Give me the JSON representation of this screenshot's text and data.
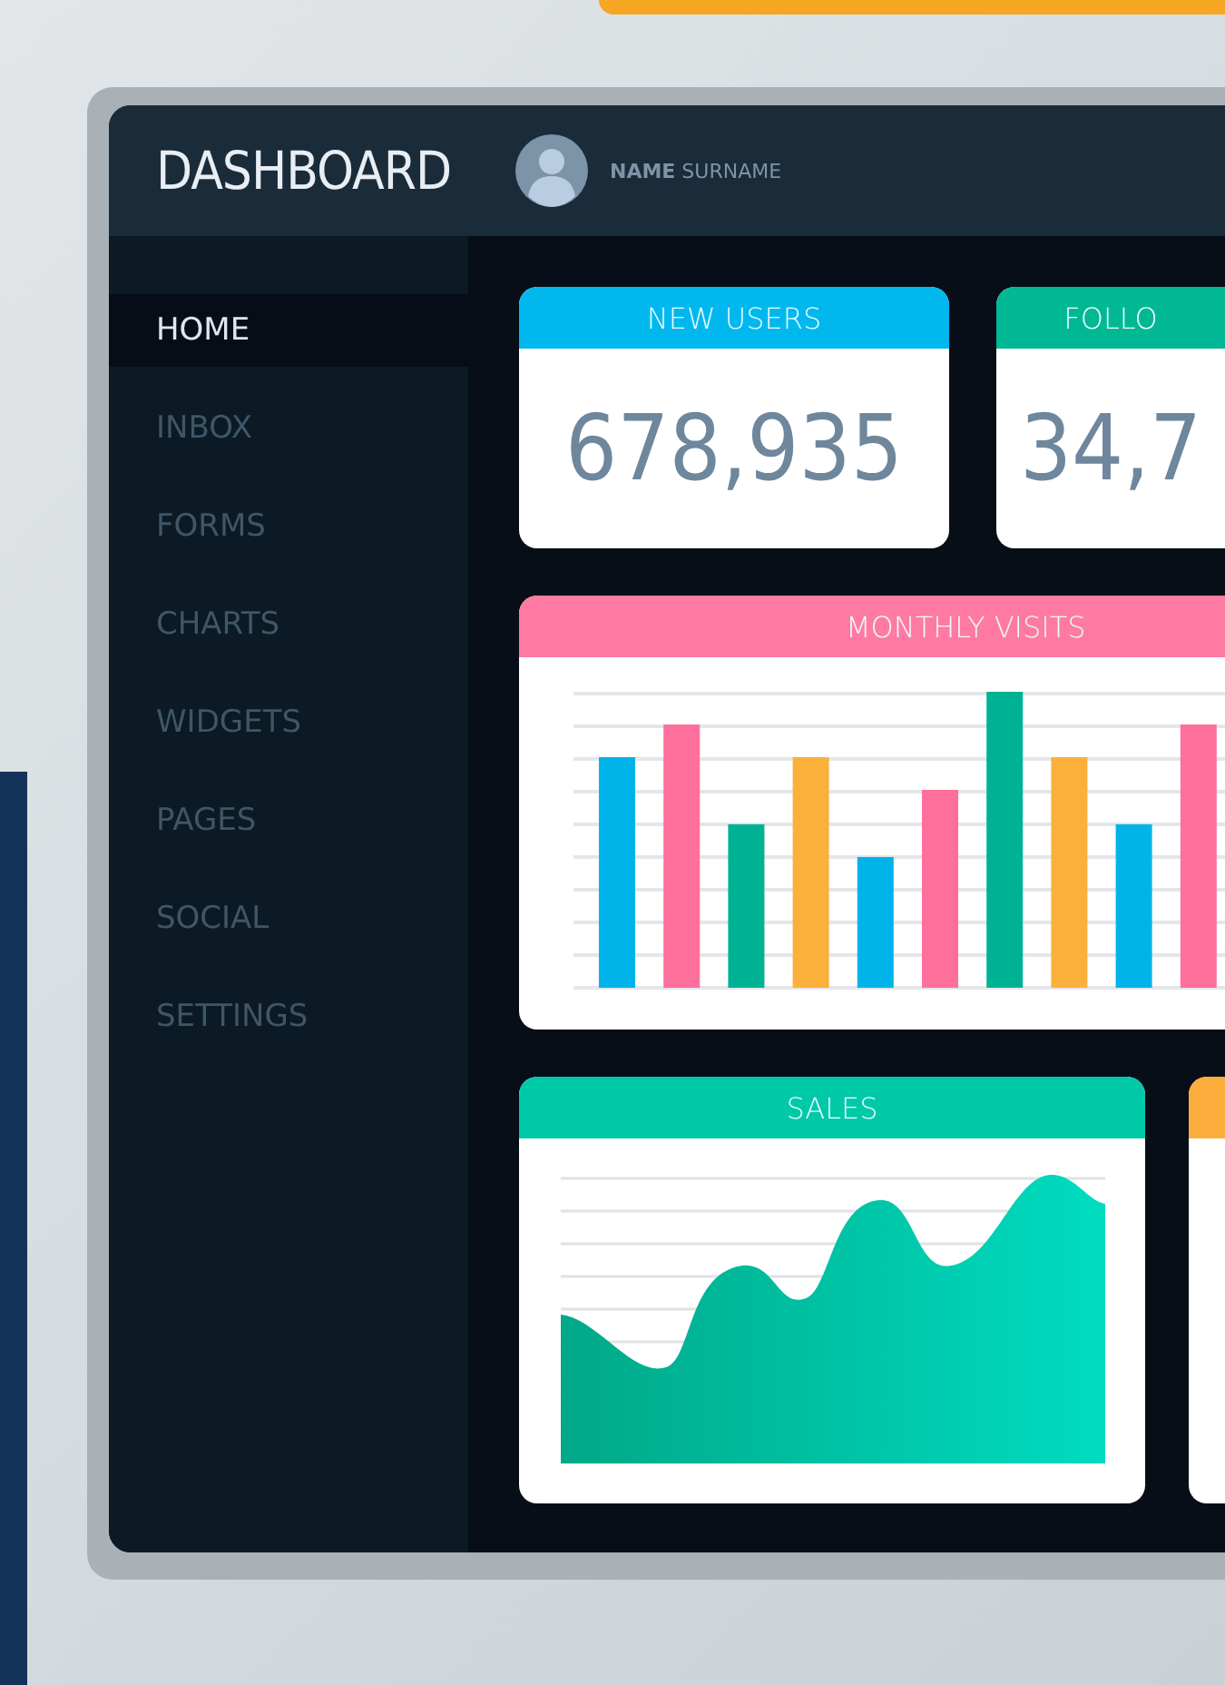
{
  "header": {
    "title": "DASHBOARD",
    "user_name": "**NAME** SURNAME"
  },
  "sidebar": {
    "items": [
      {
        "label": "HOME",
        "selected": true
      },
      {
        "label": "INBOX",
        "selected": false
      },
      {
        "label": "FORMS",
        "selected": false
      },
      {
        "label": "CHARTS",
        "selected": false
      },
      {
        "label": "WIDGETS",
        "selected": false
      },
      {
        "label": "PAGES",
        "selected": false
      },
      {
        "label": "SOCIAL",
        "selected": false
      },
      {
        "label": "SETTINGS",
        "selected": false
      }
    ]
  },
  "stat_cards": [
    {
      "title": "NEW USERS",
      "value": "678,935",
      "color": "#00b8ee"
    },
    {
      "title": "FOLLO",
      "value": "34,7",
      "color": "#00b894"
    }
  ],
  "panels": [
    {
      "kind": "bar",
      "title": "MONTHLY VISITS",
      "color": "#ff7aa2"
    },
    {
      "kind": "area",
      "title": "SALES",
      "color": "#00c9a7"
    },
    {
      "kind": "blank",
      "color": "#fbae3c"
    }
  ]
}
